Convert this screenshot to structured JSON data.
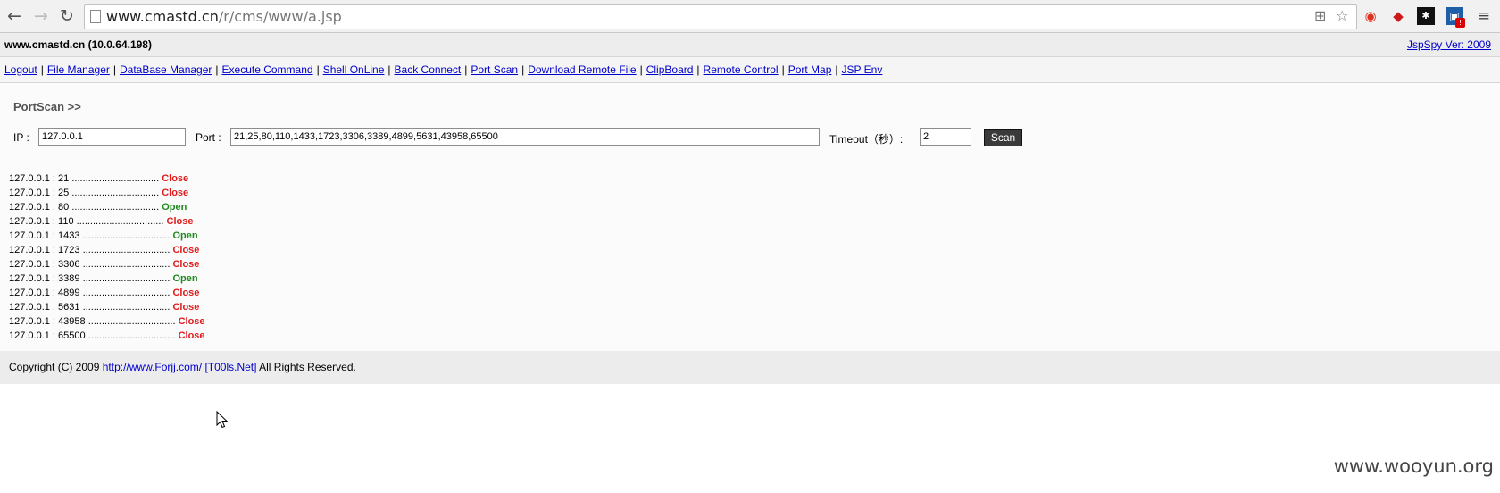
{
  "browser": {
    "url_host": "www.cmastd.cn",
    "url_path": "/r/cms/www/a.jsp"
  },
  "header": {
    "host": "www.cmastd.cn (10.0.64.198)",
    "version": "JspSpy Ver: 2009"
  },
  "menu": [
    "Logout",
    "File Manager",
    "DataBase Manager",
    "Execute Command",
    "Shell OnLine",
    "Back Connect",
    "Port Scan",
    "Download Remote File",
    "ClipBoard",
    "Remote Control",
    "Port Map",
    "JSP Env"
  ],
  "portscan": {
    "title": "PortScan >>",
    "ip_label": "IP :",
    "ip_value": "127.0.0.1",
    "port_label": "Port :",
    "port_value": "21,25,80,110,1433,1723,3306,3389,4899,5631,43958,65500",
    "timeout_label": "Timeout（秒）:",
    "timeout_value": "2",
    "scan_label": "Scan"
  },
  "results": [
    {
      "target": "127.0.0.1 : 21",
      "status": "Close"
    },
    {
      "target": "127.0.0.1 : 25",
      "status": "Close"
    },
    {
      "target": "127.0.0.1 : 80",
      "status": "Open"
    },
    {
      "target": "127.0.0.1 : 110",
      "status": "Close"
    },
    {
      "target": "127.0.0.1 : 1433",
      "status": "Open"
    },
    {
      "target": "127.0.0.1 : 1723",
      "status": "Close"
    },
    {
      "target": "127.0.0.1 : 3306",
      "status": "Close"
    },
    {
      "target": "127.0.0.1 : 3389",
      "status": "Open"
    },
    {
      "target": "127.0.0.1 : 4899",
      "status": "Close"
    },
    {
      "target": "127.0.0.1 : 5631",
      "status": "Close"
    },
    {
      "target": "127.0.0.1 : 43958",
      "status": "Close"
    },
    {
      "target": "127.0.0.1 : 65500",
      "status": "Close"
    }
  ],
  "dots": "................................",
  "footer": {
    "copyright": "Copyright (C) 2009",
    "link1": "http://www.Forjj.com/",
    "link2": "[T00ls.Net]",
    "rights": "All Rights Reserved."
  },
  "watermark": "www.wooyun.org",
  "colors": {
    "open": "#1d8a1d",
    "close": "#e01b1b",
    "link": "#0000cc"
  }
}
